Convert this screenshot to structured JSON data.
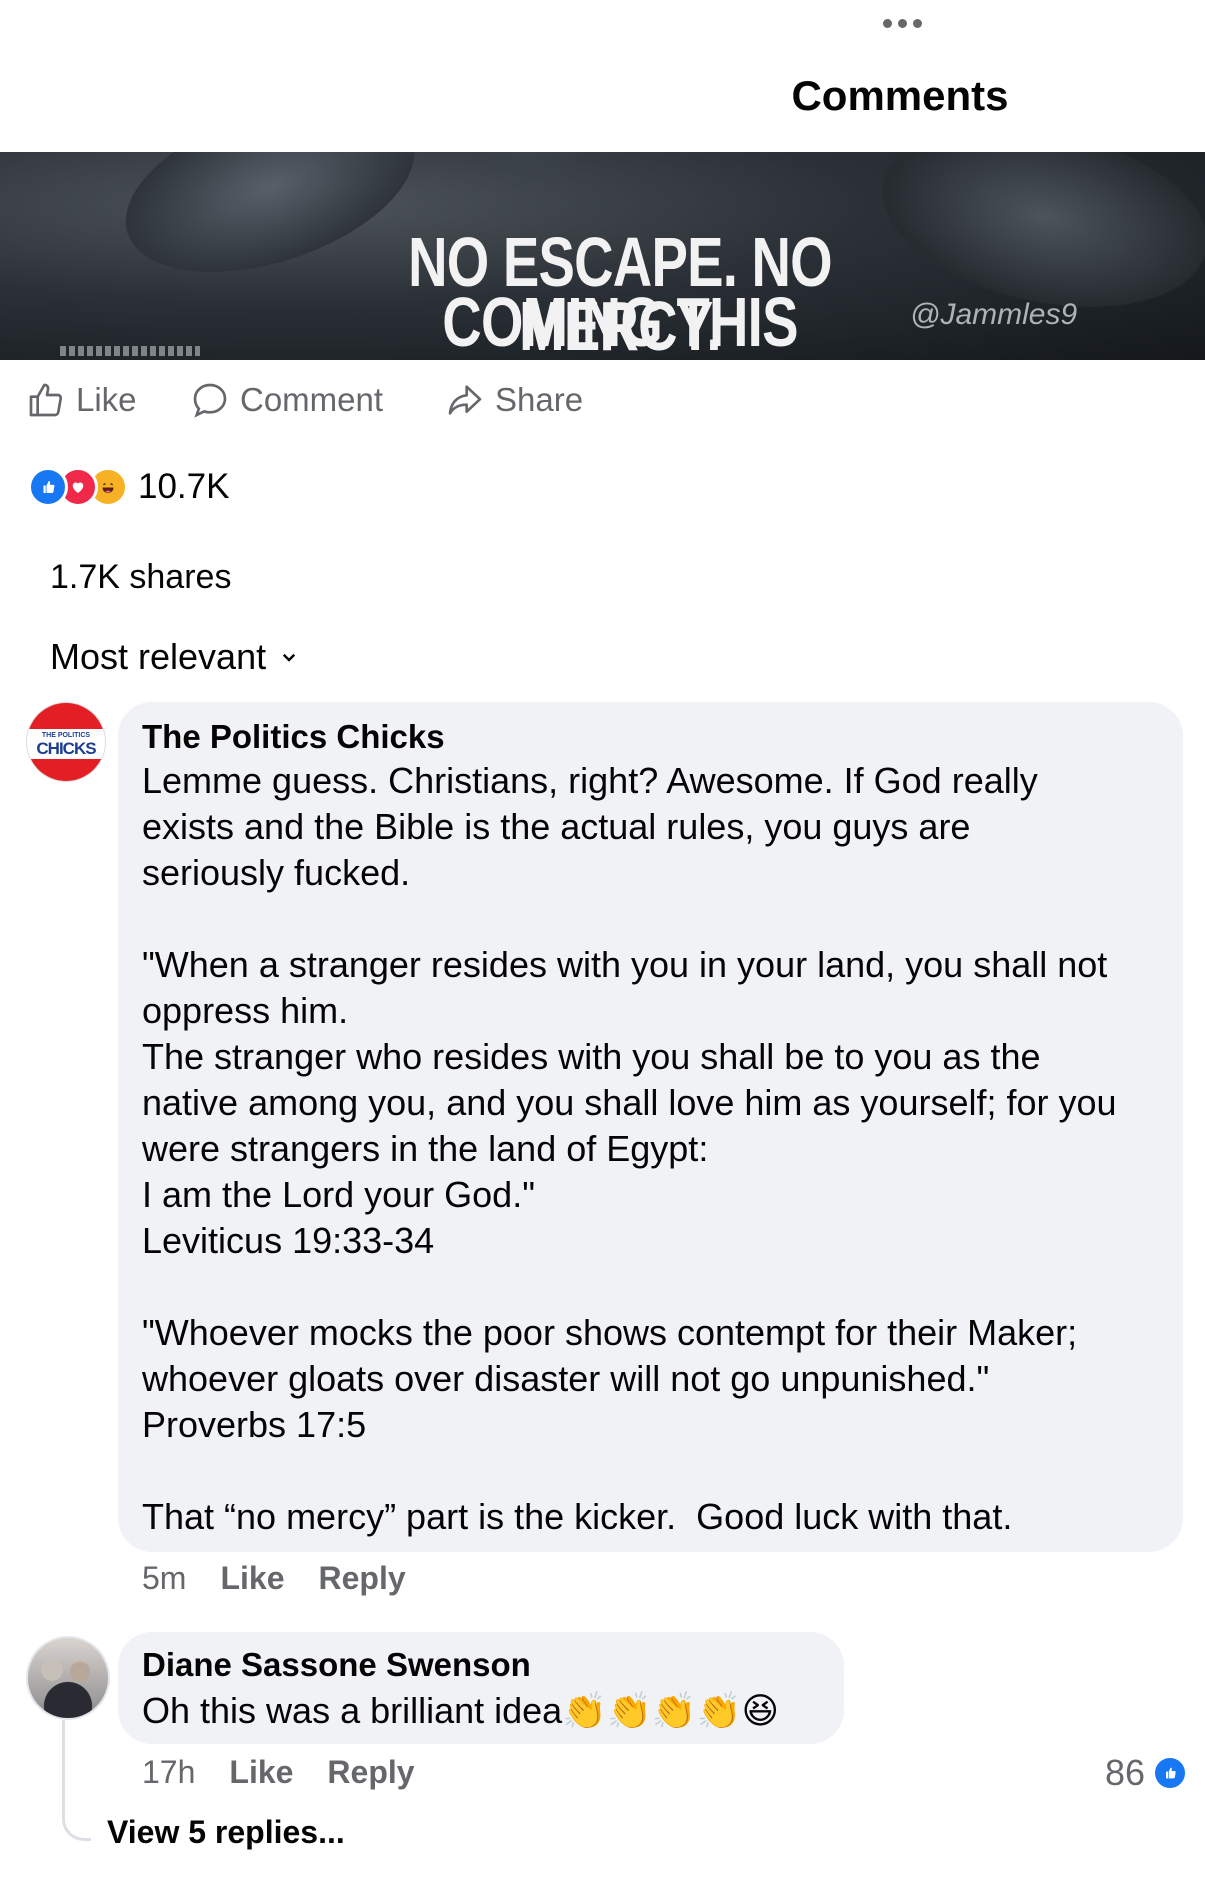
{
  "header": {
    "title": "Comments"
  },
  "post": {
    "banner": {
      "line1": "NO ESCAPE. NO MERCY.",
      "line2": "COMING THIS SUMMER.",
      "watermark": "@Jammles9"
    },
    "actions": {
      "like": "Like",
      "comment": "Comment",
      "share": "Share"
    },
    "reactions": {
      "types": [
        "like",
        "love",
        "haha"
      ],
      "count": "10.7K"
    },
    "shares": "1.7K shares",
    "sort_label": "Most relevant"
  },
  "comments": [
    {
      "author": "The Politics Chicks",
      "avatar_text_small": "THE POLITICS",
      "avatar_text_big": "CHICKS",
      "body": "Lemme guess. Christians, right? Awesome. If God really\nexists and the Bible is the actual rules, you guys are\nseriously fucked.\n\n\"When a stranger resides with you in your land, you shall not\noppress him.\nThe stranger who resides with you shall be to you as the\nnative among you, and you shall love him as yourself; for you\nwere strangers in the land of Egypt:\nI am the Lord your God.\"\nLeviticus 19:33-34\n\n\"Whoever mocks the poor shows contempt for their Maker;\nwhoever gloats over disaster will not go unpunished.\"\nProverbs 17:5\n\nThat “no mercy” part is the kicker.  Good luck with that.",
      "time": "5m",
      "like_label": "Like",
      "reply_label": "Reply"
    },
    {
      "author": "Diane Sassone Swenson",
      "body": "Oh this was a brilliant idea👏👏👏👏😆",
      "time": "17h",
      "like_label": "Like",
      "reply_label": "Reply",
      "like_count": "86",
      "view_replies": "View 5 replies..."
    }
  ]
}
